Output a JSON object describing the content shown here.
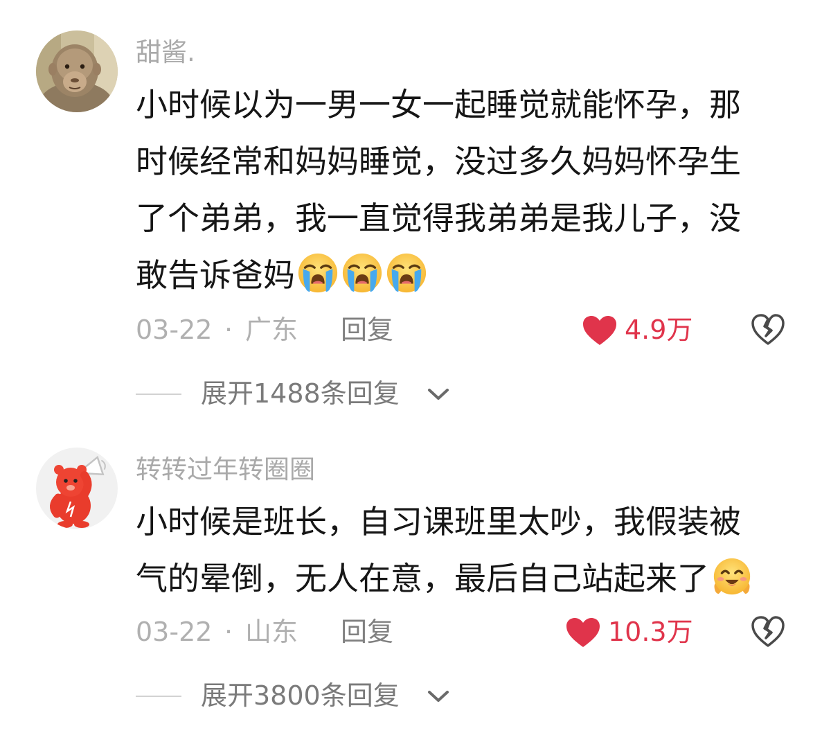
{
  "comments": [
    {
      "username": "甜酱.",
      "avatar": "monkey-avatar",
      "text_lines": [
        "小时候以为一男一女一起睡觉就能怀孕，那",
        "时候经常和妈妈睡觉，没过多久妈妈怀孕生",
        "了个弟弟，我一直觉得我弟弟是我儿子，没",
        "敢告诉爸妈"
      ],
      "emojis": [
        "loudly-crying-face",
        "loudly-crying-face",
        "loudly-crying-face"
      ],
      "date": "03-22",
      "separator": "·",
      "location": "广东",
      "reply_label": "回复",
      "likes": "4.9万",
      "expand_label": "展开1488条回复"
    },
    {
      "username": "转转过年转圈圈",
      "avatar": "red-bear-megaphone-avatar",
      "text_lines": [
        "小时候是班长，自习课班里太吵，我假装被",
        "气的晕倒，无人在意，最后自己站起来了"
      ],
      "emojis": [
        "smiling-face-with-smiling-eyes"
      ],
      "date": "03-22",
      "separator": "·",
      "location": "山东",
      "reply_label": "回复",
      "likes": "10.3万",
      "expand_label": "展开3800条回复"
    }
  ],
  "colors": {
    "username": "#a9a9a9",
    "text": "#161616",
    "meta": "#b0b0b0",
    "like": "#e0344b",
    "expand": "#7a7a7a"
  }
}
